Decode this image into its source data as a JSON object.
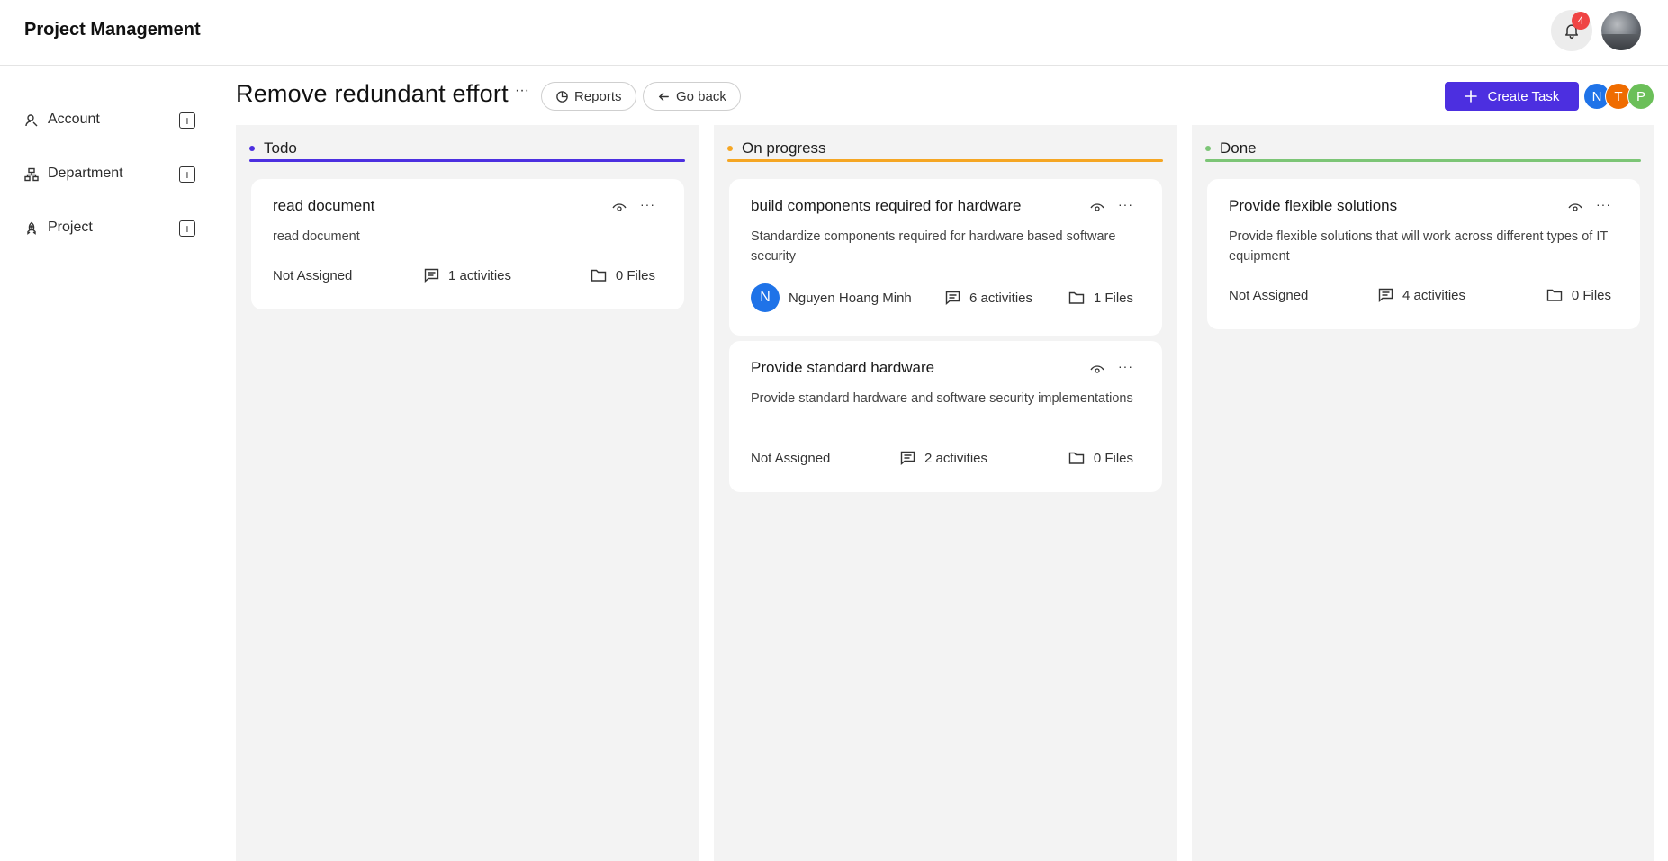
{
  "app": {
    "title": "Project Management",
    "notification_count": "4"
  },
  "sidebar": {
    "items": [
      {
        "label": "Account",
        "icon": "account-icon"
      },
      {
        "label": "Department",
        "icon": "department-icon"
      },
      {
        "label": "Project",
        "icon": "rocket-icon"
      }
    ]
  },
  "header": {
    "title": "Remove redundant effort",
    "more": "···",
    "reports_label": "Reports",
    "go_back_label": "Go back",
    "create_label": "Create Task",
    "members": [
      {
        "initial": "N",
        "color": "#1f73e8"
      },
      {
        "initial": "T",
        "color": "#ef6c00"
      },
      {
        "initial": "P",
        "color": "#6bbf59"
      }
    ]
  },
  "columns": [
    {
      "title": "Todo",
      "color": "#4c2fe0",
      "cards": [
        {
          "title": "read document",
          "description": "read document",
          "assignee": "Not Assigned",
          "activities": "1 activities",
          "files": "0 Files"
        }
      ]
    },
    {
      "title": "On progress",
      "color": "#f5a623",
      "cards": [
        {
          "title": "build components required for hardware",
          "description": "Standardize components required for hardware based software security",
          "assignee": "Nguyen Hoang Minh",
          "assignee_initial": "N",
          "activities": "6 activities",
          "files": "1 Files"
        },
        {
          "title": "Provide standard hardware",
          "description": "Provide standard hardware and software security implementations",
          "assignee": "Not Assigned",
          "activities": "2 activities",
          "files": "0 Files"
        }
      ]
    },
    {
      "title": "Done",
      "color": "#7cc576",
      "cards": [
        {
          "title": "Provide flexible solutions",
          "description": "Provide flexible solutions that will work across different types of IT equipment",
          "assignee": "Not Assigned",
          "activities": "4 activities",
          "files": "0 Files"
        }
      ]
    }
  ]
}
